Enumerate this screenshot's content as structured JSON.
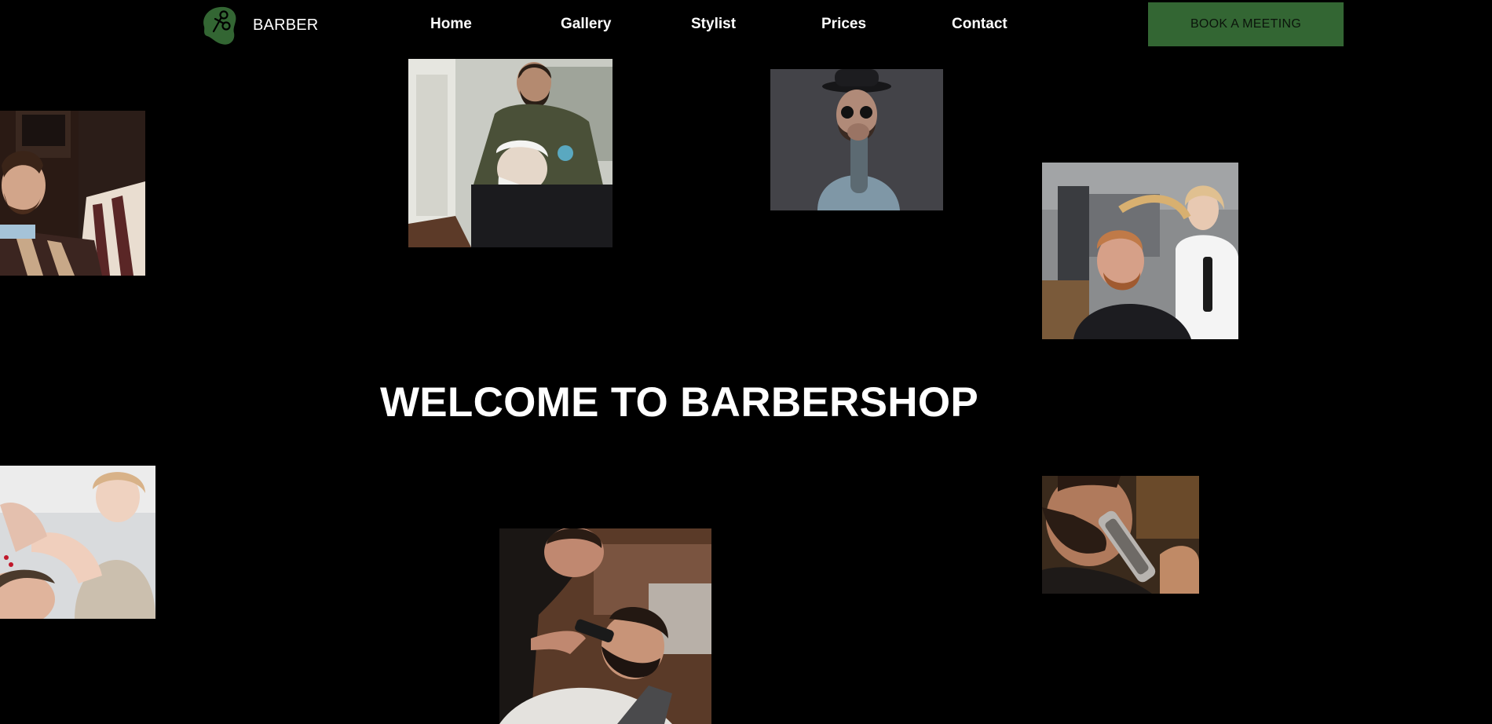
{
  "header": {
    "brand": "BARBER",
    "logo_icon": "scissors-leaf-logo-icon",
    "nav": [
      {
        "label": "Home"
      },
      {
        "label": "Gallery"
      },
      {
        "label": "Stylist"
      },
      {
        "label": "Prices"
      },
      {
        "label": "Contact"
      }
    ],
    "cta_label": "BOOK A MEETING"
  },
  "hero": {
    "title": "WELCOME TO BARBERSHOP"
  },
  "colors": {
    "background": "#000000",
    "accent": "#336633",
    "text": "#ffffff"
  }
}
